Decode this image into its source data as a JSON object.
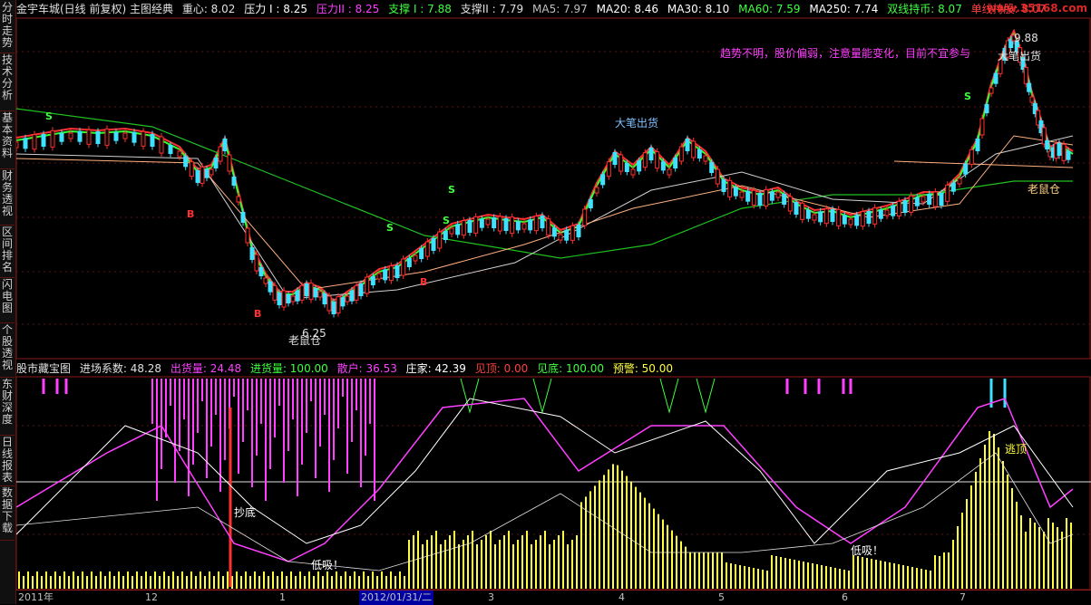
{
  "sidebar": {
    "tabs": [
      {
        "label": "分时走势"
      },
      {
        "label": "技术分析"
      },
      {
        "label": "基本资料"
      },
      {
        "label": "财务透视"
      },
      {
        "label": "区间排名"
      },
      {
        "label": "闪电图"
      },
      {
        "label": "个股透视"
      },
      {
        "label": "东财深度"
      },
      {
        "label": "日线报表"
      },
      {
        "label": "数据下载"
      }
    ]
  },
  "header": {
    "title": "金宇车城(日线 前复权) 主图经典",
    "items": [
      {
        "text": "重心: 8.02",
        "color": "#e0e0e0"
      },
      {
        "text": "压力 I : 8.25",
        "color": "#ffffff"
      },
      {
        "text": "压力II : 8.25",
        "color": "#ff40ff"
      },
      {
        "text": "支撑 I : 7.88",
        "color": "#40ff40"
      },
      {
        "text": "支撑II : 7.79",
        "color": "#e0e0e0"
      },
      {
        "text": "MA5: 7.97",
        "color": "#c0c0c0"
      },
      {
        "text": "MA20: 8.46",
        "color": "#ffffff"
      },
      {
        "text": "MA30: 8.10",
        "color": "#ffffff"
      },
      {
        "text": "MA60: 7.59",
        "color": "#40ff40"
      },
      {
        "text": "MA250: 7.74",
        "color": "#ffffff"
      },
      {
        "text": "双线持币: 8.07",
        "color": "#40ff40"
      },
      {
        "text": "单线持股: 8.07",
        "color": "#ff4040"
      }
    ],
    "watermark": "www.35168.com"
  },
  "price_chart": {
    "note": "趋势不明，股价偏弱，注意量能变化，目前不宜参与",
    "labels": [
      {
        "text": "大笔出货",
        "kind": "sell"
      },
      {
        "text": "大笔出货",
        "kind": "sell"
      },
      {
        "text": "老鼠仓",
        "kind": "rat"
      },
      {
        "text": "老鼠仓",
        "kind": "rat"
      },
      {
        "text": "9.88",
        "kind": "high"
      },
      {
        "text": "6.25",
        "kind": "low"
      }
    ],
    "signals": {
      "buy": "B",
      "sell": "S"
    }
  },
  "indicator": {
    "title": "股市藏宝图",
    "items": [
      {
        "text": "进场系数: 48.28",
        "color": "#e0e0e0"
      },
      {
        "text": "出货量: 24.48",
        "color": "#ff40ff"
      },
      {
        "text": "进货量: 100.00",
        "color": "#40ff40"
      },
      {
        "text": "散户: 36.53",
        "color": "#ff40ff"
      },
      {
        "text": "庄家: 42.39",
        "color": "#ffffff"
      },
      {
        "text": "见顶: 0.00",
        "color": "#ff4040"
      },
      {
        "text": "见底: 100.00",
        "color": "#40ff40"
      },
      {
        "text": "预警: 50.00",
        "color": "#ffff40"
      }
    ],
    "labels": [
      {
        "text": "抄底",
        "kind": "bottom"
      },
      {
        "text": "低吸！",
        "kind": "dip"
      },
      {
        "text": "低吸！",
        "kind": "dip"
      },
      {
        "text": "逃顶",
        "kind": "top"
      }
    ]
  },
  "axis": {
    "ticks": [
      "2011年",
      "12",
      "1",
      "2012/01/31/二",
      "3",
      "4",
      "5",
      "6",
      "7"
    ]
  }
}
